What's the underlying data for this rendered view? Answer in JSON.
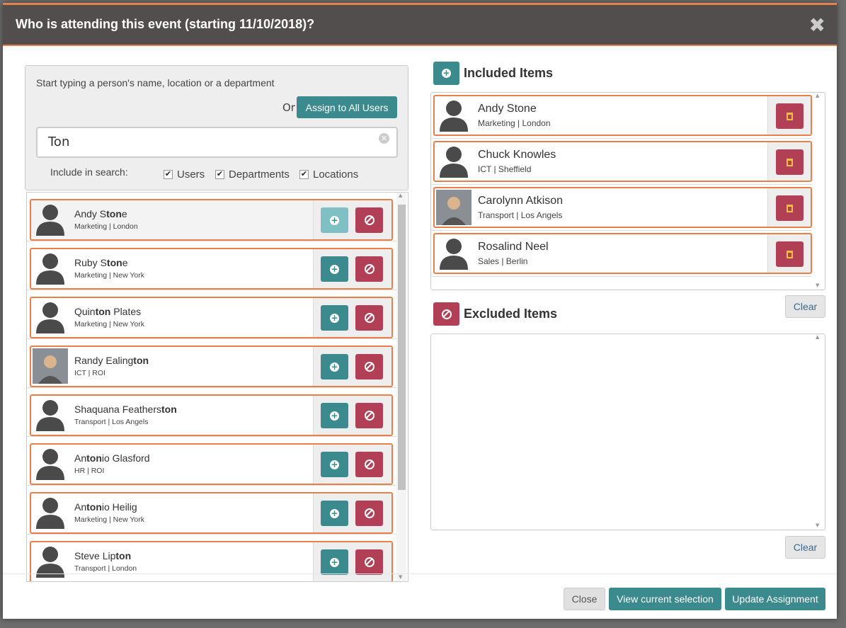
{
  "dialog": {
    "title": "Who is attending this event (starting 11/10/2018)?",
    "close_icon": "close-icon"
  },
  "search": {
    "hint": "Start typing a person's name, location or a department",
    "or_label": "Or",
    "assign_all_label": "Assign to All Users",
    "query": "Ton",
    "include_label": "Include in search:",
    "filters": [
      {
        "label": "Users",
        "checked": true
      },
      {
        "label": "Departments",
        "checked": true
      },
      {
        "label": "Locations",
        "checked": true
      }
    ]
  },
  "results": [
    {
      "pre": "Andy S",
      "match": "ton",
      "post": "e",
      "sub": "Marketing | London",
      "photo": false,
      "added": true
    },
    {
      "pre": "Ruby S",
      "match": "ton",
      "post": "e",
      "sub": "Marketing | New York",
      "photo": false
    },
    {
      "pre": "Quin",
      "match": "ton",
      "post": " Plates",
      "sub": "Marketing | New York",
      "photo": false
    },
    {
      "pre": "Randy Ealing",
      "match": "ton",
      "post": "",
      "sub": "ICT | ROI",
      "photo": true
    },
    {
      "pre": "Shaquana Feathers",
      "match": "ton",
      "post": "",
      "sub": "Transport | Los Angels",
      "photo": false
    },
    {
      "pre": "An",
      "match": "ton",
      "post": "io Glasford",
      "sub": "HR | ROI",
      "photo": false
    },
    {
      "pre": "An",
      "match": "ton",
      "post": "io Heilig",
      "sub": "Marketing | New York",
      "photo": false
    },
    {
      "pre": "Steve Lip",
      "match": "ton",
      "post": "",
      "sub": "Transport | London",
      "photo": false
    }
  ],
  "included": {
    "title": "Included Items",
    "clear_label": "Clear",
    "items": [
      {
        "name": "Andy Stone",
        "sub": "Marketing | London",
        "photo": false
      },
      {
        "name": "Chuck Knowles",
        "sub": "ICT | Sheffield",
        "photo": false
      },
      {
        "name": "Carolynn Atkison",
        "sub": "Transport | Los Angels",
        "photo": true
      },
      {
        "name": "Rosalind Neel",
        "sub": "Sales | Berlin",
        "photo": false
      }
    ]
  },
  "excluded": {
    "title": "Excluded Items",
    "clear_label": "Clear"
  },
  "footer": {
    "close_label": "Close",
    "view_label": "View current selection",
    "update_label": "Update Assignment"
  },
  "colors": {
    "accent": "#e8804a",
    "teal": "#3a8a8e",
    "red": "#b13f55",
    "header": "#524e4e"
  }
}
